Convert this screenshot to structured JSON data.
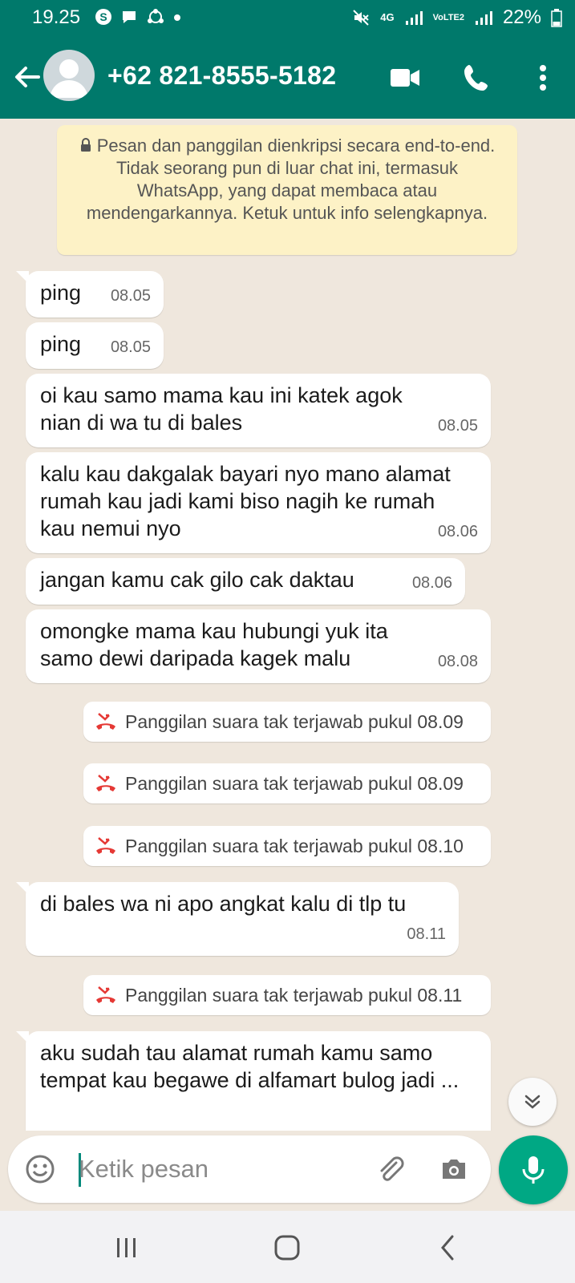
{
  "status_bar": {
    "time": "19.25",
    "battery": "22%",
    "network": "4G",
    "volte": "VoLTE2"
  },
  "header": {
    "contact": "+62 821-8555-5182"
  },
  "encryption_banner": "Pesan dan panggilan dienkripsi secara end-to-end. Tidak seorang pun di luar chat ini, termasuk WhatsApp, yang dapat membaca atau mendengarkannya. Ketuk untuk info selengkapnya.",
  "messages": [
    {
      "text": "ping",
      "time": "08.05"
    },
    {
      "text": "ping",
      "time": "08.05"
    },
    {
      "text": "oi kau samo mama kau ini katek agok nian di wa tu di bales",
      "time": "08.05"
    },
    {
      "text": "kalu kau dakgalak bayari nyo mano alamat rumah kau jadi kami biso nagih ke rumah kau nemui nyo",
      "time": "08.06"
    },
    {
      "text": "jangan kamu cak gilo cak daktau",
      "time": "08.06"
    },
    {
      "text": "omongke mama kau hubungi yuk ita samo dewi daripada kagek malu",
      "time": "08.08"
    },
    {
      "text": "di bales wa ni apo angkat kalu di tlp tu",
      "time": "08.11"
    },
    {
      "text": "aku sudah tau alamat rumah kamu samo tempat kau begawe di alfamart bulog jadi ...",
      "time": ""
    }
  ],
  "missed_calls": [
    "Panggilan suara tak terjawab pukul 08.09",
    "Panggilan suara tak terjawab pukul 08.09",
    "Panggilan suara tak terjawab pukul 08.10",
    "Panggilan suara tak terjawab pukul 08.11"
  ],
  "composer": {
    "placeholder": "Ketik pesan"
  },
  "colors": {
    "header": "#00796b",
    "accent": "#00a884",
    "missed_call": "#e53935",
    "banner": "#fdf2c6",
    "chat_bg": "#efe7dd"
  }
}
